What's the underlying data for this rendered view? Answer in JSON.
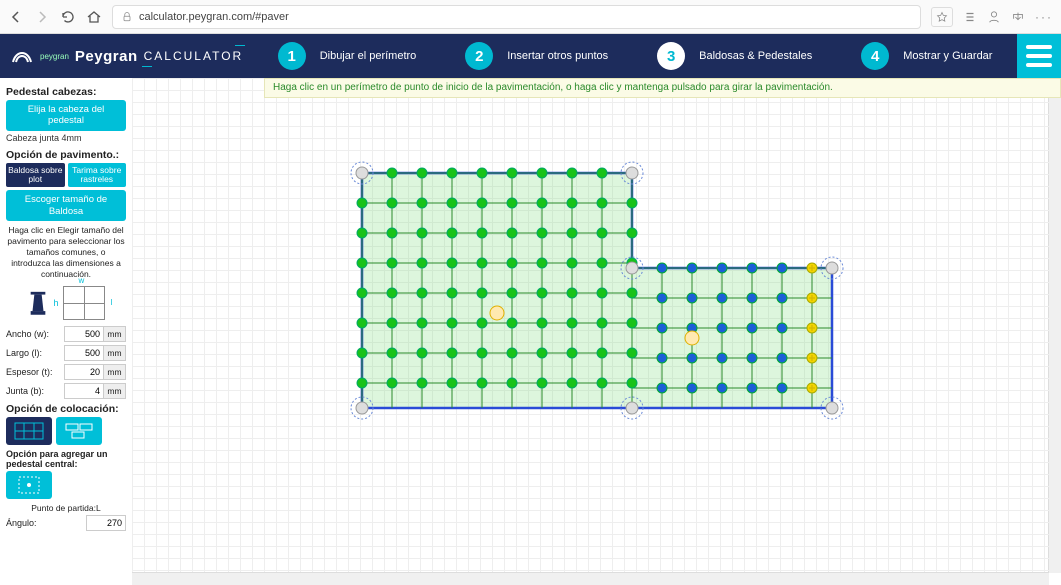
{
  "browser": {
    "url": "calculator.peygran.com/#paver"
  },
  "brand": {
    "name": "Peygran",
    "product": "CALCULATOR",
    "sub": "peygran"
  },
  "steps": [
    {
      "num": "1",
      "label": "Dibujar el perímetro"
    },
    {
      "num": "2",
      "label": "Insertar otros puntos"
    },
    {
      "num": "3",
      "label": "Baldosas & Pedestales"
    },
    {
      "num": "4",
      "label": "Mostrar y Guardar"
    }
  ],
  "hint": "Haga clic en un perímetro de punto de inicio de la pavimentación, o haga clic y mantenga pulsado para girar la pavimentación.",
  "sidebar": {
    "head_label": "Pedestal cabezas:",
    "choose_head": "Elija la cabeza del pedestal",
    "head_note": "Cabeza junta 4mm",
    "pav_option": "Opción de pavimento.:",
    "opt1": "Baldosa sobre plot",
    "opt2": "Tarima sobre rastreles",
    "choose_tile": "Escoger tamaño de Baldosa",
    "help": "Haga clic en Elegir tamaño del pavimento para seleccionar los tamaños comunes, o introduzca las dimensiones a continuación.",
    "dims": {
      "w_label": "Ancho (w):",
      "w_val": "500",
      "w_unit": "mm",
      "l_label": "Largo (l):",
      "l_val": "500",
      "l_unit": "mm",
      "t_label": "Espesor (t):",
      "t_val": "20",
      "t_unit": "mm",
      "b_label": "Junta (b):",
      "b_val": "4",
      "b_unit": "mm"
    },
    "placement": "Opción de colocación:",
    "center_ped": "Opción para agregar un pedestal central:",
    "start_point": "Punto de partida:L",
    "angle_label": "Ángulo:",
    "angle_val": "270"
  }
}
